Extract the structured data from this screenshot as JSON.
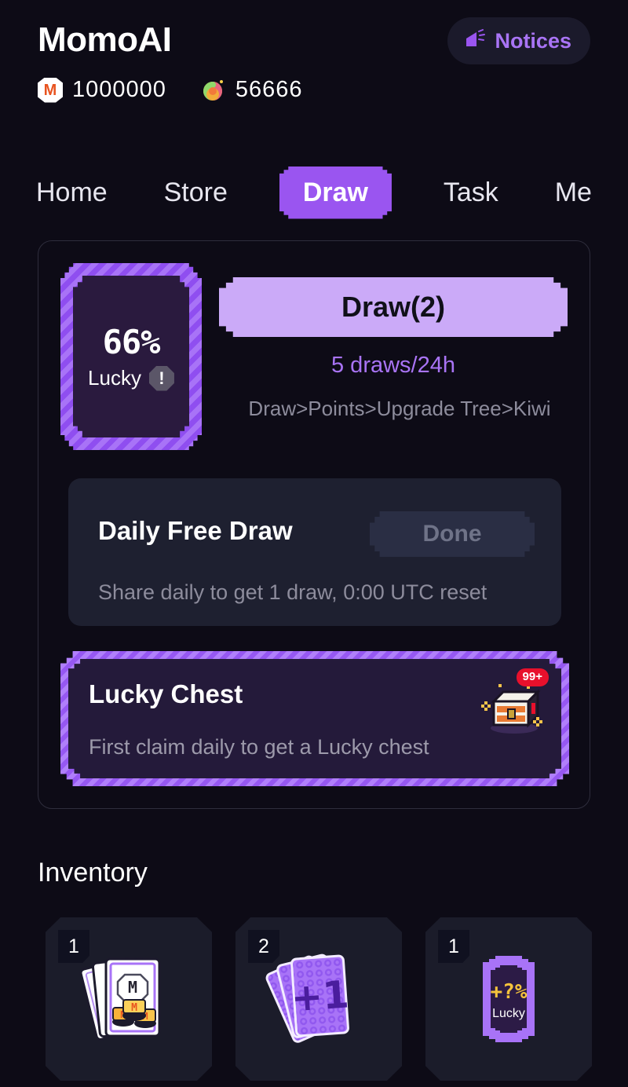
{
  "header": {
    "app_title": "MomoAI",
    "notices": {
      "label": "Notices",
      "icon": "megaphone-icon"
    },
    "currencies": [
      {
        "icon": "momo-coin-icon",
        "symbol": "M",
        "value": "1000000"
      },
      {
        "icon": "candy-swirl-icon",
        "value": "56666"
      }
    ]
  },
  "nav": {
    "tabs": [
      {
        "label": "Home",
        "active": false
      },
      {
        "label": "Store",
        "active": false
      },
      {
        "label": "Draw",
        "active": true
      },
      {
        "label": "Task",
        "active": false
      },
      {
        "label": "Me",
        "active": false
      }
    ],
    "active_color": "#9a55f0"
  },
  "draw_panel": {
    "lucky_card": {
      "percent": "66%",
      "label": "Lucky",
      "warning_icon": "!",
      "border_color": "#9a55f0",
      "fill_color": "#2a1a3e"
    },
    "draw_button": {
      "label": "Draw(2)",
      "color": "#cbaaf8"
    },
    "draws_note": "5  draws/24h",
    "draws_note_color": "#a974f5",
    "upgrade_path": "Draw>Points>Upgrade  Tree>Kiwi",
    "daily_free_draw": {
      "title": "Daily Free Draw",
      "subtitle": "Share daily to get 1 draw, 0:00 UTC reset",
      "action_label": "Done",
      "action_state": "disabled"
    },
    "lucky_chest": {
      "title": "Lucky Chest",
      "subtitle": "First claim daily to get a Lucky chest",
      "badge": "99+",
      "badge_color": "#e8102c",
      "icon": "treasure-chest-icon"
    }
  },
  "inventory": {
    "title": "Inventory",
    "items": [
      {
        "count": "1",
        "icon": "momo-points-card-icon",
        "art_label": "M"
      },
      {
        "count": "2",
        "icon": "plus-one-card-icon",
        "art_label": "+1"
      },
      {
        "count": "1",
        "icon": "lucky-percent-card-icon",
        "art_label": "+?%",
        "sub_label": "Lucky"
      }
    ]
  }
}
